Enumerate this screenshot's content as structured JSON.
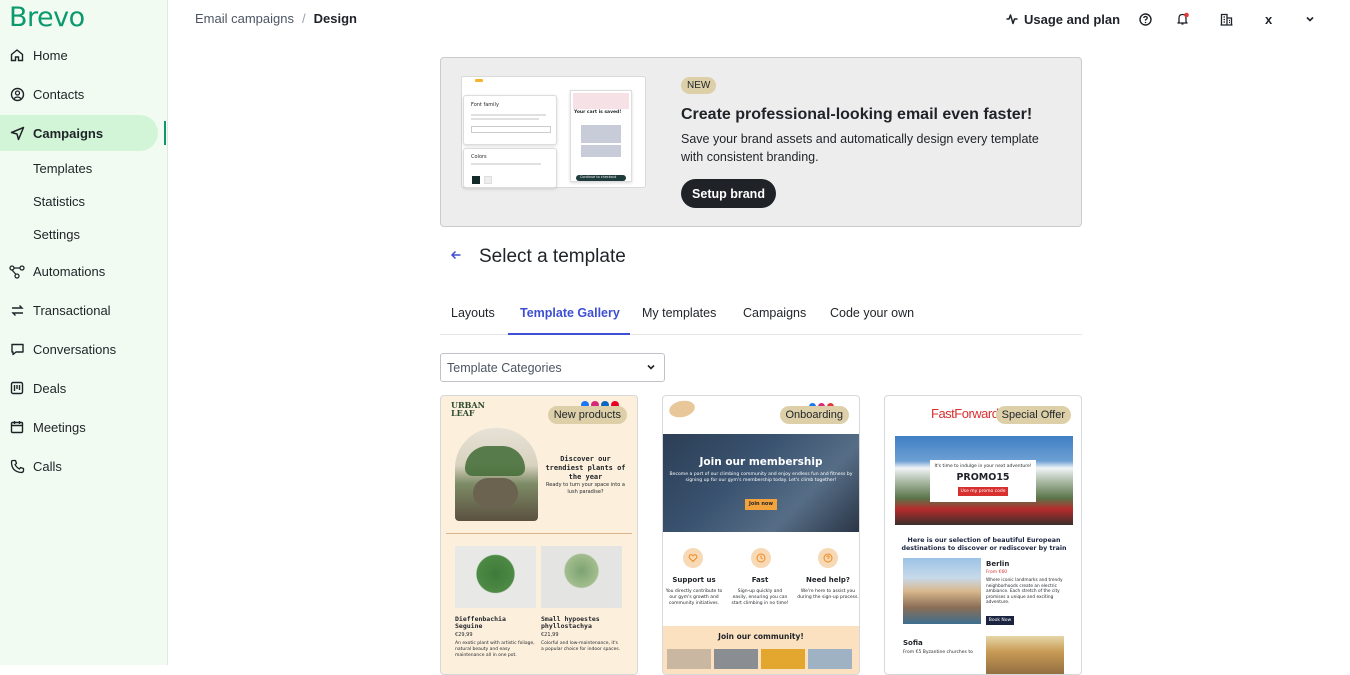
{
  "brand": {
    "logo": "Brevo",
    "color": "#0b996e"
  },
  "sidebar": {
    "items": [
      {
        "label": "Home",
        "icon": "home-icon"
      },
      {
        "label": "Contacts",
        "icon": "contacts-icon"
      },
      {
        "label": "Campaigns",
        "icon": "send-icon",
        "active": true
      },
      {
        "label": "Automations",
        "icon": "automations-icon"
      },
      {
        "label": "Transactional",
        "icon": "transactional-icon"
      },
      {
        "label": "Conversations",
        "icon": "chat-icon"
      },
      {
        "label": "Deals",
        "icon": "deals-icon"
      },
      {
        "label": "Meetings",
        "icon": "calendar-icon"
      },
      {
        "label": "Calls",
        "icon": "phone-icon"
      }
    ],
    "sub_items": [
      "Templates",
      "Statistics",
      "Settings"
    ]
  },
  "breadcrumb": {
    "parent": "Email campaigns",
    "separator": "/",
    "current": "Design"
  },
  "header": {
    "usage_label": "Usage and plan",
    "account_initial": "x"
  },
  "banner": {
    "badge": "NEW",
    "title": "Create professional-looking email even faster!",
    "description": "Save your brand assets and automatically design every template with consistent branding.",
    "button": "Setup brand",
    "preview": {
      "font_family_title": "Font family",
      "colors_title": "Colors",
      "cart_title": "Your cart is saved!",
      "cart_button": "Continue to checkout"
    }
  },
  "section": {
    "title": "Select a template"
  },
  "tabs": [
    "Layouts",
    "Template Gallery",
    "My templates",
    "Campaigns",
    "Code your own"
  ],
  "active_tab": 1,
  "category_select": {
    "value": "Template Categories"
  },
  "cards": [
    {
      "tag": "New products",
      "brand": "URBAN LEAF",
      "headline": "Discover our trendiest plants of the year",
      "subline": "Ready to turn your space into a lush paradise?",
      "products": [
        {
          "name": "Dieffenbachia Seguine",
          "price": "€29,99",
          "desc": "An exotic plant with artistic foliage, natural beauty and easy maintenance all in one pot."
        },
        {
          "name": "Small hypoestes phyllostachya",
          "price": "€21,99",
          "desc": "Colorful and low-maintenance, it's a popular choice for indoor spaces."
        }
      ]
    },
    {
      "tag": "Onboarding",
      "hero_title": "Join our membership",
      "hero_text": "Become a part of our climbing community and enjoy endless fun and fitness by signing up for our gym's membership today. Let's climb together!",
      "hero_button": "Join now",
      "features": [
        {
          "title": "Support us",
          "text": "You directly contribute to our gym's growth and community initiatives."
        },
        {
          "title": "Fast",
          "text": "Sign-up quickly and easily, ensuring you can start climbing in no time!"
        },
        {
          "title": "Need help?",
          "text": "We're here to assist you during the sign-up process."
        }
      ],
      "community": "Join our community!"
    },
    {
      "tag": "Special Offer",
      "brand": "FastForward",
      "promo_intro": "It's time to indulge in your next adventure!",
      "promo_code": "PROMO15",
      "promo_button": "Use my promo code",
      "selection_title": "Here is our selection of beautiful European destinations to discover or rediscover by train",
      "destinations": [
        {
          "city": "Berlin",
          "price": "From €60",
          "text": "Where iconic landmarks and trendy neighborhoods create an electric ambiance. Each stretch of the city promises a unique and exciting adventure.",
          "button": "Book Now"
        },
        {
          "city": "Sofia",
          "price": "From €5 Byzantine churches to"
        }
      ]
    }
  ]
}
